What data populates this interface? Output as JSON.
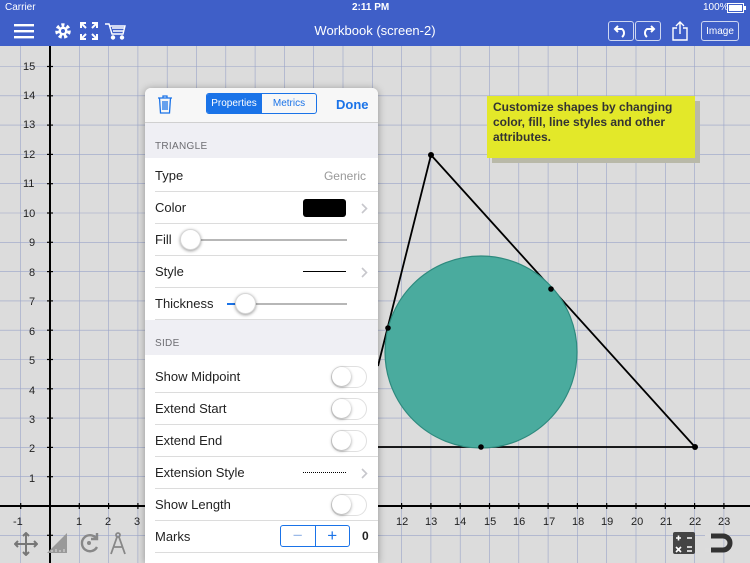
{
  "status_bar": {
    "carrier": "Carrier",
    "time": "2:11 PM",
    "battery": "100%"
  },
  "nav_bar": {
    "title": "Workbook (screen-2)",
    "image_label": "Image",
    "icons": [
      "menu-icon",
      "gear-icon",
      "fullscreen-icon",
      "cart-icon",
      "undo-icon",
      "redo-icon",
      "share-icon"
    ]
  },
  "tooltip": {
    "text": "Customize shapes by changing color, fill, line styles and other attributes."
  },
  "graph": {
    "x_ticks": [
      "-1",
      "1",
      "2",
      "3",
      "12",
      "13",
      "14",
      "15",
      "16",
      "17",
      "18",
      "19",
      "20",
      "21",
      "22",
      "23"
    ],
    "y_ticks": [
      "15",
      "14",
      "13",
      "12",
      "11",
      "10",
      "9",
      "8",
      "7",
      "6",
      "5",
      "4",
      "3",
      "2",
      "1"
    ],
    "circle_color": "#4aab9e",
    "grid_color": "#9aa4c8"
  },
  "panel": {
    "tabs": {
      "properties": "Properties",
      "metrics": "Metrics"
    },
    "done": "Done",
    "section_triangle": "TRIANGLE",
    "type_label": "Type",
    "type_value": "Generic",
    "color_label": "Color",
    "color_value": "#000000",
    "fill_label": "Fill",
    "fill_level": 0.0,
    "style_label": "Style",
    "thickness_label": "Thickness",
    "thickness_level": 0.2,
    "section_side": "SIDE",
    "show_midpoint": "Show Midpoint",
    "extend_start": "Extend Start",
    "extend_end": "Extend End",
    "extension_style": "Extension Style",
    "show_length": "Show Length",
    "marks_label": "Marks",
    "marks_value": "0",
    "toggles": {
      "show_midpoint": false,
      "extend_start": false,
      "extend_end": false,
      "show_length": false
    }
  },
  "bottom_toolbar": {
    "icons": [
      "move-icon",
      "ruler-icon",
      "rotate-icon",
      "compass-icon",
      "calculator-icon",
      "magnet-icon"
    ]
  }
}
